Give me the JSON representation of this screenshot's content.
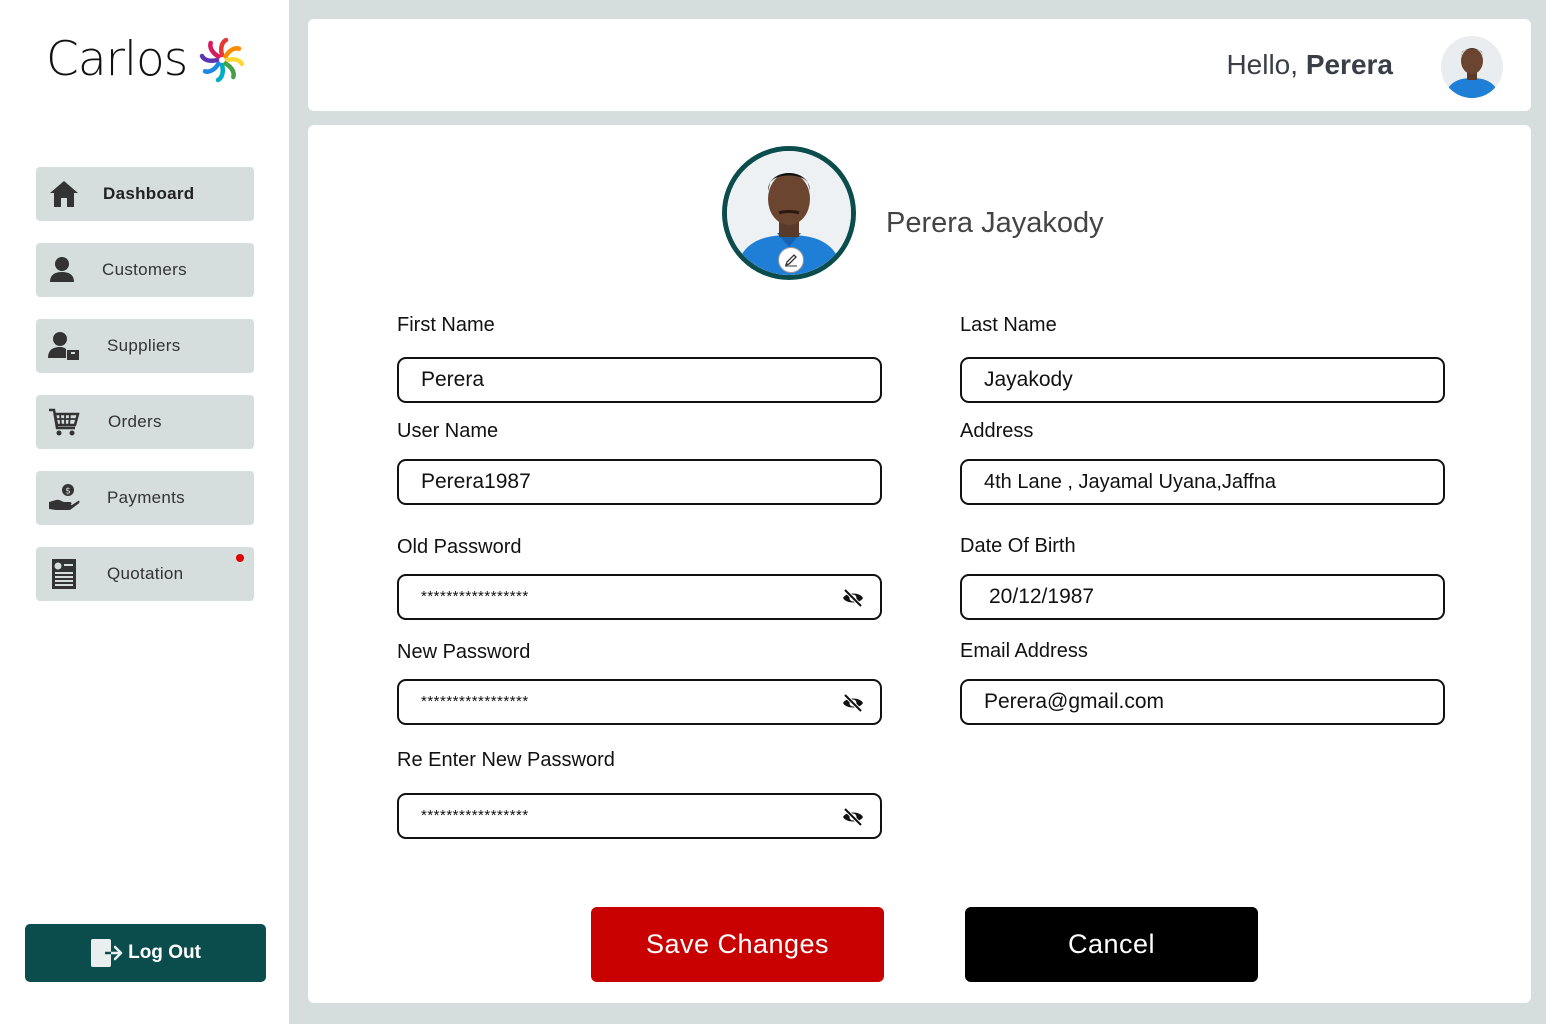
{
  "brand": {
    "name": "Carlos",
    "logo_icon": "flower-pinwheel-icon"
  },
  "sidebar": {
    "items": [
      {
        "label": "Dashboard",
        "icon": "home-icon",
        "active": true
      },
      {
        "label": "Customers",
        "icon": "person-icon",
        "active": false
      },
      {
        "label": "Suppliers",
        "icon": "supplier-icon",
        "active": false
      },
      {
        "label": "Orders",
        "icon": "cart-icon",
        "active": false
      },
      {
        "label": "Payments",
        "icon": "hand-coin-icon",
        "active": false
      },
      {
        "label": "Quotation",
        "icon": "invoice-icon",
        "active": false,
        "notification": true
      }
    ],
    "logout_label": "Log Out"
  },
  "header": {
    "greeting": "Hello,",
    "user_first_name": "Perera"
  },
  "profile": {
    "full_name": "Perera Jayakody",
    "fields": {
      "first_name": {
        "label": "First Name",
        "value": "Perera"
      },
      "last_name": {
        "label": "Last Name",
        "value": "Jayakody"
      },
      "user_name": {
        "label": "User Name",
        "value": "Perera1987"
      },
      "address": {
        "label": "Address",
        "value": "4th Lane , Jayamal Uyana,Jaffna"
      },
      "old_password": {
        "label": "Old Password",
        "value": "*****************"
      },
      "date_of_birth": {
        "label": "Date Of Birth",
        "value": "20/12/1987"
      },
      "new_password": {
        "label": "New Password",
        "value": "*****************"
      },
      "email": {
        "label": "Email Address",
        "value": "Perera@gmail.com"
      },
      "re_new_password": {
        "label": "Re Enter New Password",
        "value": "*****************"
      }
    }
  },
  "actions": {
    "save_label": "Save Changes",
    "cancel_label": "Cancel"
  },
  "colors": {
    "accent": "#0b4c4d",
    "save": "#c80000",
    "cancel": "#000000",
    "notification": "#e00000"
  }
}
